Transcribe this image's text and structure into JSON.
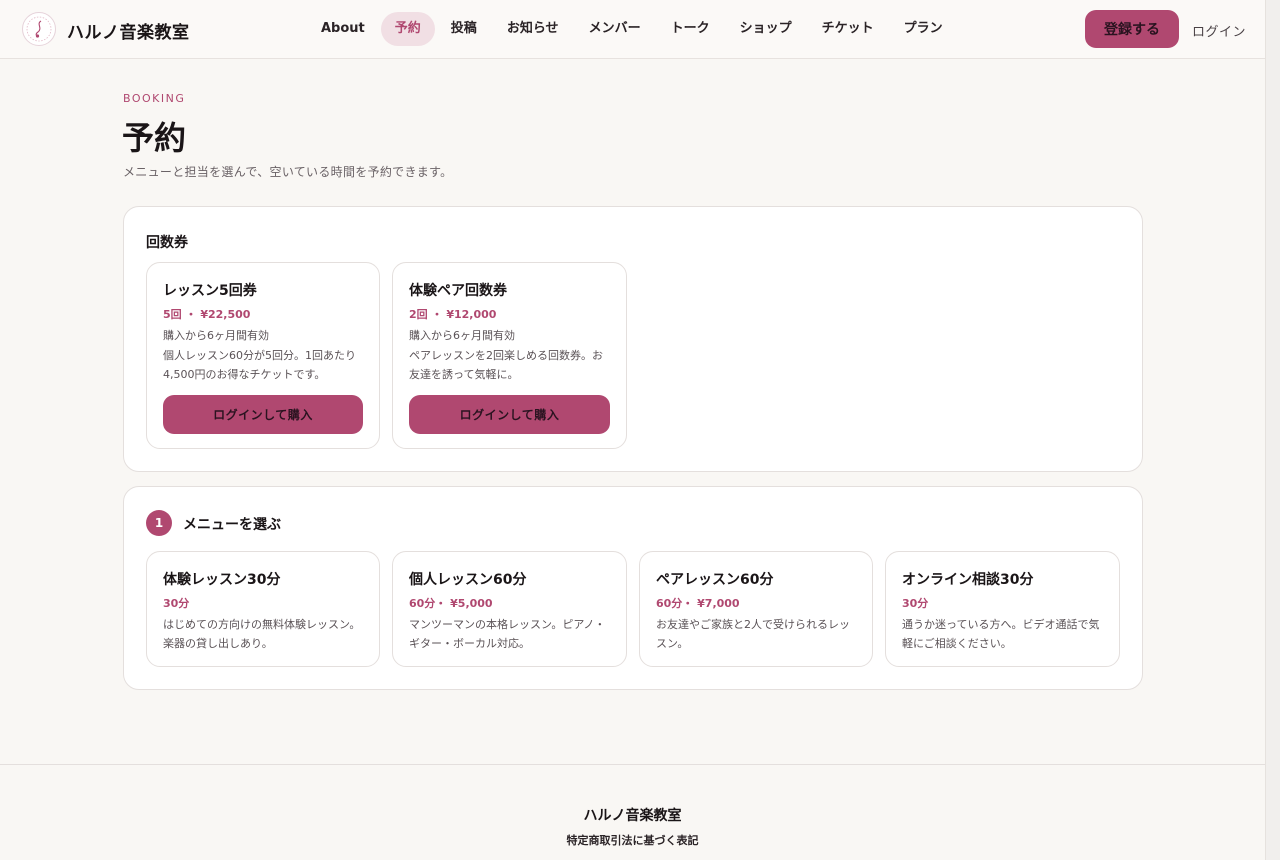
{
  "header": {
    "logo_text": "ハルノ音楽教室",
    "logo_icon": "music-note-logo-icon",
    "nav": [
      {
        "label": "About",
        "active": false
      },
      {
        "label": "予約",
        "active": true
      },
      {
        "label": "投稿",
        "active": false
      },
      {
        "label": "お知らせ",
        "active": false
      },
      {
        "label": "メンバー",
        "active": false
      },
      {
        "label": "トーク",
        "active": false
      },
      {
        "label": "ショップ",
        "active": false
      },
      {
        "label": "チケット",
        "active": false
      },
      {
        "label": "プラン",
        "active": false
      }
    ],
    "register_label": "登録する",
    "login_label": "ログイン"
  },
  "page": {
    "eyebrow": "BOOKING",
    "title": "予約",
    "description": "メニューと担当を選んで、空いている時間を予約できます。"
  },
  "tickets": {
    "heading": "回数券",
    "items": [
      {
        "title": "レッスン5回券",
        "price": "5回 ・ ¥22,500",
        "validity": "購入から6ヶ月間有効",
        "description": "個人レッスン60分が5回分。1回あたり4,500円のお得なチケットです。",
        "button_label": "ログインして購入"
      },
      {
        "title": "体験ペア回数券",
        "price": "2回 ・ ¥12,000",
        "validity": "購入から6ヶ月間有効",
        "description": "ペアレッスンを2回楽しめる回数券。お友達を誘って気軽に。",
        "button_label": "ログインして購入"
      }
    ]
  },
  "menu_step": {
    "step_number": "1",
    "heading": "メニューを選ぶ",
    "items": [
      {
        "title": "体験レッスン30分",
        "price": "30分",
        "description": "はじめての方向けの無料体験レッスン。楽器の貸し出しあり。"
      },
      {
        "title": "個人レッスン60分",
        "price": "60分・ ¥5,000",
        "description": "マンツーマンの本格レッスン。ピアノ・ギター・ボーカル対応。"
      },
      {
        "title": "ペアレッスン60分",
        "price": "60分・ ¥7,000",
        "description": "お友達やご家族と2人で受けられるレッスン。"
      },
      {
        "title": "オンライン相談30分",
        "price": "30分",
        "description": "通うか迷っている方へ。ビデオ通話で気軽にご相談ください。"
      }
    ]
  },
  "footer": {
    "title": "ハルノ音楽教室",
    "legal_link": "特定商取引法に基づく表記"
  },
  "colors": {
    "accent": "#b04870",
    "accent_soft": "#f1dfe4",
    "background": "#f9f7f4"
  }
}
